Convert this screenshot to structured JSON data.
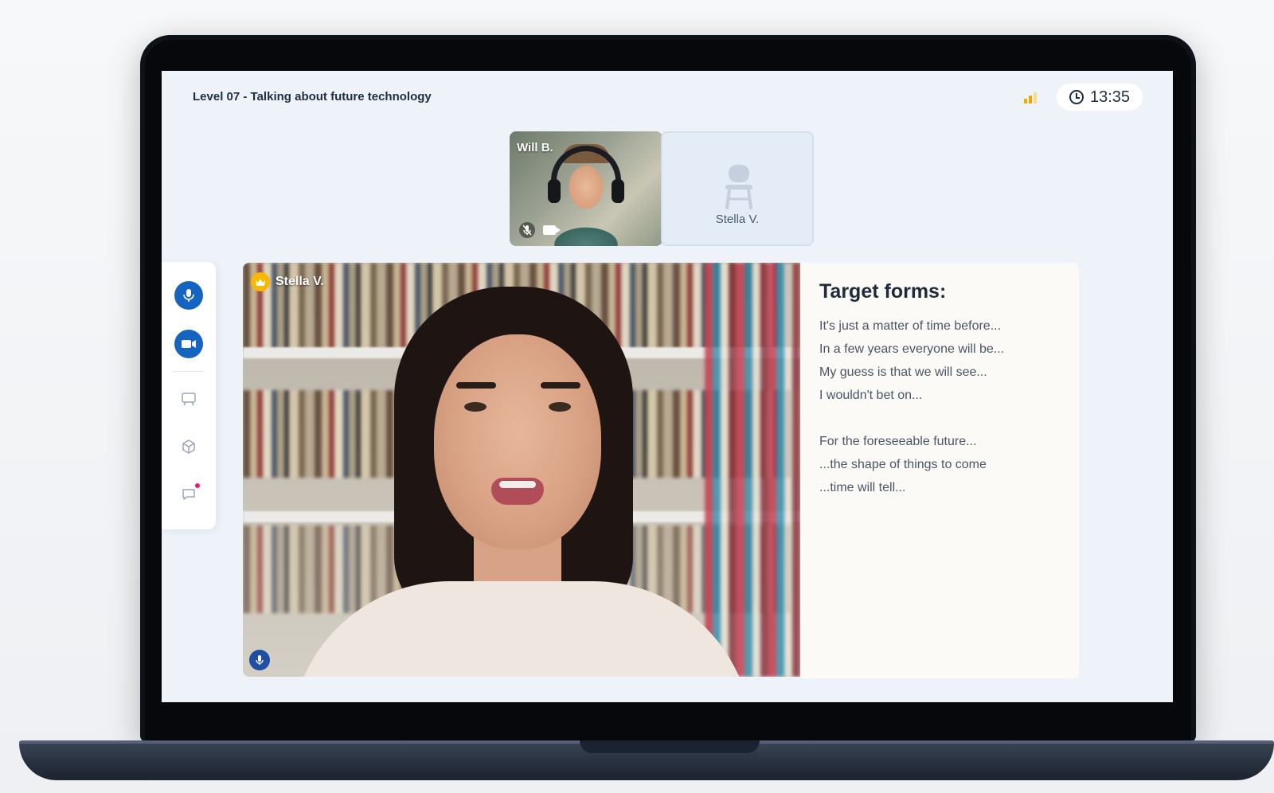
{
  "header": {
    "lesson_title": "Level 07 - Talking about future technology",
    "timer": "13:35"
  },
  "participants": {
    "tile1_name": "Will B.",
    "tile2_name": "Stella V."
  },
  "main_video": {
    "speaker_name": "Stella V."
  },
  "panel": {
    "title": "Target forms:",
    "lines_group1": [
      "It's just a matter of time before...",
      "In a few years everyone will be...",
      "My guess is that we will see...",
      "I wouldn't bet on..."
    ],
    "lines_group2": [
      "For the foreseeable future...",
      "...the shape of things to come",
      "...time will tell..."
    ]
  },
  "colors": {
    "accent": "#1565c0",
    "crown": "#f6b800",
    "signal": "#f0a500",
    "notification_dot": "#e91e63"
  },
  "icons": {
    "toolbar": [
      "microphone-icon",
      "camera-icon",
      "whiteboard-icon",
      "cube-icon",
      "chat-icon"
    ]
  }
}
